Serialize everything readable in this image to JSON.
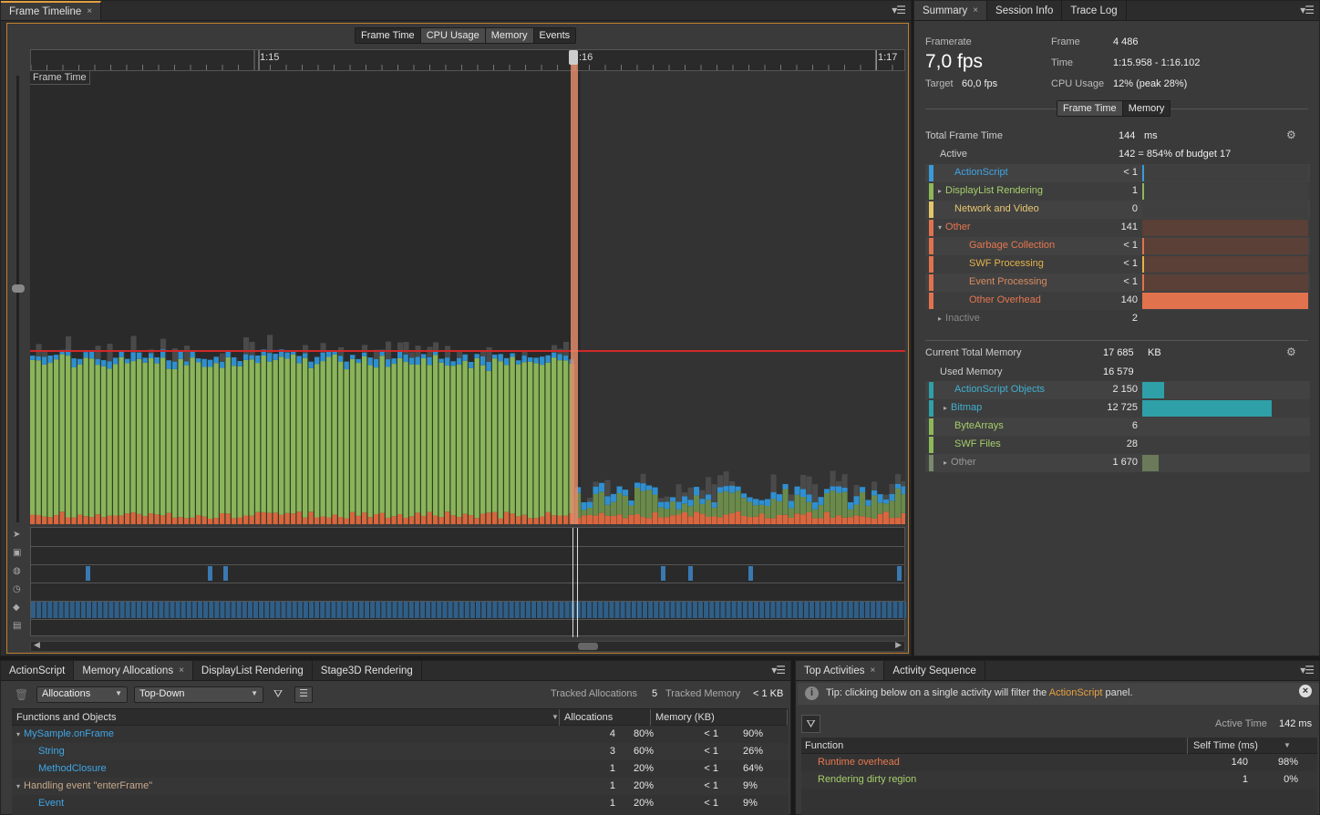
{
  "timeline": {
    "tab_title": "Frame Timeline",
    "view_tabs": [
      "Frame Time",
      "CPU Usage",
      "Memory",
      "Events"
    ],
    "ruler_labels": [
      "1:15",
      ":16",
      "1:17"
    ],
    "chart_label": "Frame Time"
  },
  "summary": {
    "tabs": [
      "Summary",
      "Session Info",
      "Trace Log"
    ],
    "framerate_label": "Framerate",
    "framerate_value": "7,0 fps",
    "target_label": "Target",
    "target_value": "60,0 fps",
    "frame_label": "Frame",
    "frame_value": "4 486",
    "time_label": "Time",
    "time_value": "1:15.958 - 1:16.102",
    "cpu_label": "CPU Usage",
    "cpu_value": "12% (peak 28%)",
    "toggle": [
      "Frame Time",
      "Memory"
    ],
    "total_frame_label": "Total Frame Time",
    "total_frame_value": "144",
    "total_frame_unit": "ms",
    "active_label": "Active",
    "active_value": "142 = 854% of budget 17",
    "frame_rows": [
      {
        "label": "ActionScript",
        "value": "< 1",
        "color": "#3a9ad9",
        "text": "#3fa6e6",
        "indent": 0,
        "tri": "",
        "fill": 0.003,
        "barcolor": "#3a9ad9",
        "bg": "#3f3f3f"
      },
      {
        "label": "DisplayList Rendering",
        "value": "1",
        "color": "#8db85a",
        "text": "#a6cf6a",
        "indent": 0,
        "tri": "▸",
        "fill": 0.007,
        "barcolor": "#8db85a",
        "bg": "#3f3f3f"
      },
      {
        "label": "Network and Video",
        "value": "0",
        "color": "#e3c56b",
        "text": "#e8c870",
        "indent": 0,
        "tri": "",
        "fill": 0,
        "barcolor": "#e3c56b",
        "bg": "#3f3f3f"
      },
      {
        "label": "Other",
        "value": "141",
        "color": "#e0734e",
        "text": "#e8774f",
        "indent": 0,
        "tri": "▾",
        "fill": 0,
        "barcolor": "#e0734e",
        "bg": "#5a4037"
      },
      {
        "label": "Garbage Collection",
        "value": "< 1",
        "color": "#e0734e",
        "text": "#e8774f",
        "indent": 1,
        "tri": "",
        "fill": 0.003,
        "barcolor": "#e0734e",
        "bg": "#5a4037"
      },
      {
        "label": "SWF Processing",
        "value": "< 1",
        "color": "#e0734e",
        "text": "#e3b24a",
        "indent": 1,
        "tri": "",
        "fill": 0.003,
        "barcolor": "#e3b24a",
        "bg": "#5a4037"
      },
      {
        "label": "Event Processing",
        "value": "< 1",
        "color": "#e0734e",
        "text": "#d98a60",
        "indent": 1,
        "tri": "",
        "fill": 0.003,
        "barcolor": "#e0734e",
        "bg": "#5a4037"
      },
      {
        "label": "Other Overhead",
        "value": "140",
        "color": "#e0734e",
        "text": "#e8774f",
        "indent": 1,
        "tri": "",
        "fill": 1.0,
        "barcolor": "#e0734e",
        "bg": "#5a4037"
      },
      {
        "label": "Inactive",
        "value": "2",
        "color": "",
        "text": "#888",
        "indent": 0,
        "tri": "▸",
        "fill": 0,
        "barcolor": "",
        "bg": "transparent"
      }
    ],
    "memory_label": "Current Total Memory",
    "memory_value": "17 685",
    "memory_unit": "KB",
    "used_label": "Used Memory",
    "used_value": "16 579",
    "memory_rows": [
      {
        "label": "ActionScript Objects",
        "value": "2 150",
        "color": "#2fa0a8",
        "text": "#3fb0d0",
        "tri": "",
        "fill": 0.13,
        "barcolor": "#2fa0a8"
      },
      {
        "label": "Bitmap",
        "value": "12 725",
        "color": "#2fa0a8",
        "text": "#3fb0d0",
        "tri": "▸",
        "fill": 0.78,
        "barcolor": "#2fa0a8"
      },
      {
        "label": "ByteArrays",
        "value": "6",
        "color": "#8db85a",
        "text": "#a6cf6a",
        "tri": "",
        "fill": 0,
        "barcolor": "#8db85a"
      },
      {
        "label": "SWF Files",
        "value": "28",
        "color": "#8db85a",
        "text": "#a6cf6a",
        "tri": "",
        "fill": 0,
        "barcolor": "#8db85a"
      },
      {
        "label": "Other",
        "value": "1 670",
        "color": "#7a8a6a",
        "text": "#999",
        "tri": "▸",
        "fill": 0.1,
        "barcolor": "#6a7a5a"
      }
    ]
  },
  "allocations": {
    "tabs": [
      "ActionScript",
      "Memory Allocations",
      "DisplayList Rendering",
      "Stage3D Rendering"
    ],
    "mode_select": "Allocations",
    "view_select": "Top-Down",
    "tracked_alloc_label": "Tracked Allocations",
    "tracked_alloc_value": "5",
    "tracked_mem_label": "Tracked Memory",
    "tracked_mem_value": "< 1 KB",
    "col_func": "Functions and Objects",
    "col_alloc": "Allocations",
    "col_mem": "Memory (KB)",
    "rows": [
      {
        "name": "MySample.onFrame",
        "tri": "▾",
        "indent": 0,
        "color": "#3fa6e6",
        "a": "4",
        "ap": "80%",
        "m": "< 1",
        "mp": "90%"
      },
      {
        "name": "String",
        "tri": "",
        "indent": 1,
        "color": "#3fa6e6",
        "a": "3",
        "ap": "60%",
        "m": "< 1",
        "mp": "26%"
      },
      {
        "name": "MethodClosure",
        "tri": "",
        "indent": 1,
        "color": "#3fa6e6",
        "a": "1",
        "ap": "20%",
        "m": "< 1",
        "mp": "64%"
      },
      {
        "name": "Handling event \"enterFrame\"",
        "tri": "▾",
        "indent": 0,
        "color": "#c9a98a",
        "a": "1",
        "ap": "20%",
        "m": "< 1",
        "mp": "9%"
      },
      {
        "name": "Event",
        "tri": "",
        "indent": 1,
        "color": "#3fa6e6",
        "a": "1",
        "ap": "20%",
        "m": "< 1",
        "mp": "9%"
      }
    ]
  },
  "activities": {
    "tabs": [
      "Top Activities",
      "Activity Sequence"
    ],
    "tip_prefix": "Tip: clicking below on a single activity will filter the",
    "tip_link": "ActionScript",
    "tip_suffix": "panel.",
    "active_time_label": "Active Time",
    "active_time_value": "142 ms",
    "col_func": "Function",
    "col_self": "Self Time (ms)",
    "rows": [
      {
        "name": "Runtime overhead",
        "color": "#e8774f",
        "v": "140",
        "p": "98%"
      },
      {
        "name": "Rendering dirty region",
        "color": "#a6cf6a",
        "v": "1",
        "p": "0%"
      }
    ]
  }
}
